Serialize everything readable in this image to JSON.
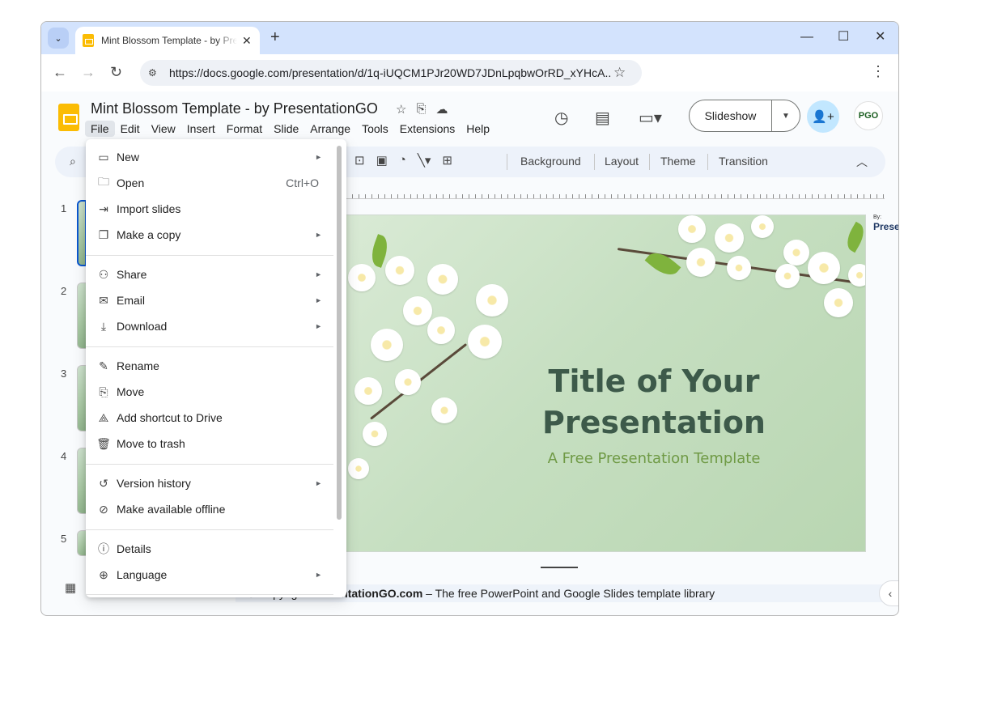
{
  "browser": {
    "tab_title": "Mint Blossom Template - by PresentationGO",
    "new_tab_icon": "+",
    "url": "https://docs.google.com/presentation/d/1q-iUQCM1PJr20WD7JDnLpqbwOrRD_xYHcA...",
    "controls": {
      "minimize": "—",
      "maximize": "☐",
      "close": "✕"
    }
  },
  "docs": {
    "title": "Mint Blossom Template - by PresentationGO",
    "menus": [
      "File",
      "Edit",
      "View",
      "Insert",
      "Format",
      "Slide",
      "Arrange",
      "Tools",
      "Extensions",
      "Help"
    ],
    "slideshow_label": "Slideshow",
    "avatar_initials": "PGO"
  },
  "toolbar": {
    "background": "Background",
    "layout": "Layout",
    "theme": "Theme",
    "transition": "Transition"
  },
  "filmstrip": {
    "numbers": [
      "1",
      "2",
      "3",
      "4",
      "5"
    ]
  },
  "slide": {
    "title_line1": "Title of Your",
    "title_line2": "Presentation",
    "subtitle": "A Free Presentation Template",
    "edge_by": "By:",
    "edge_brand": "Prese"
  },
  "notes": {
    "prefix": "© Copyright ",
    "brand": "PresentationGO.com",
    "suffix": " – The free PowerPoint and Google Slides template library"
  },
  "file_menu": {
    "new": "New",
    "open": "Open",
    "open_shortcut": "Ctrl+O",
    "import_slides": "Import slides",
    "make_copy": "Make a copy",
    "share": "Share",
    "email": "Email",
    "download": "Download",
    "rename": "Rename",
    "move": "Move",
    "add_shortcut": "Add shortcut to Drive",
    "move_to_trash": "Move to trash",
    "version_history": "Version history",
    "make_offline": "Make available offline",
    "details": "Details",
    "language": "Language"
  },
  "colors": {
    "accent": "#0b57d0",
    "slides_yellow": "#fbbc04",
    "title_green": "#3d5a4a",
    "subtitle_green": "#6f9a45"
  }
}
